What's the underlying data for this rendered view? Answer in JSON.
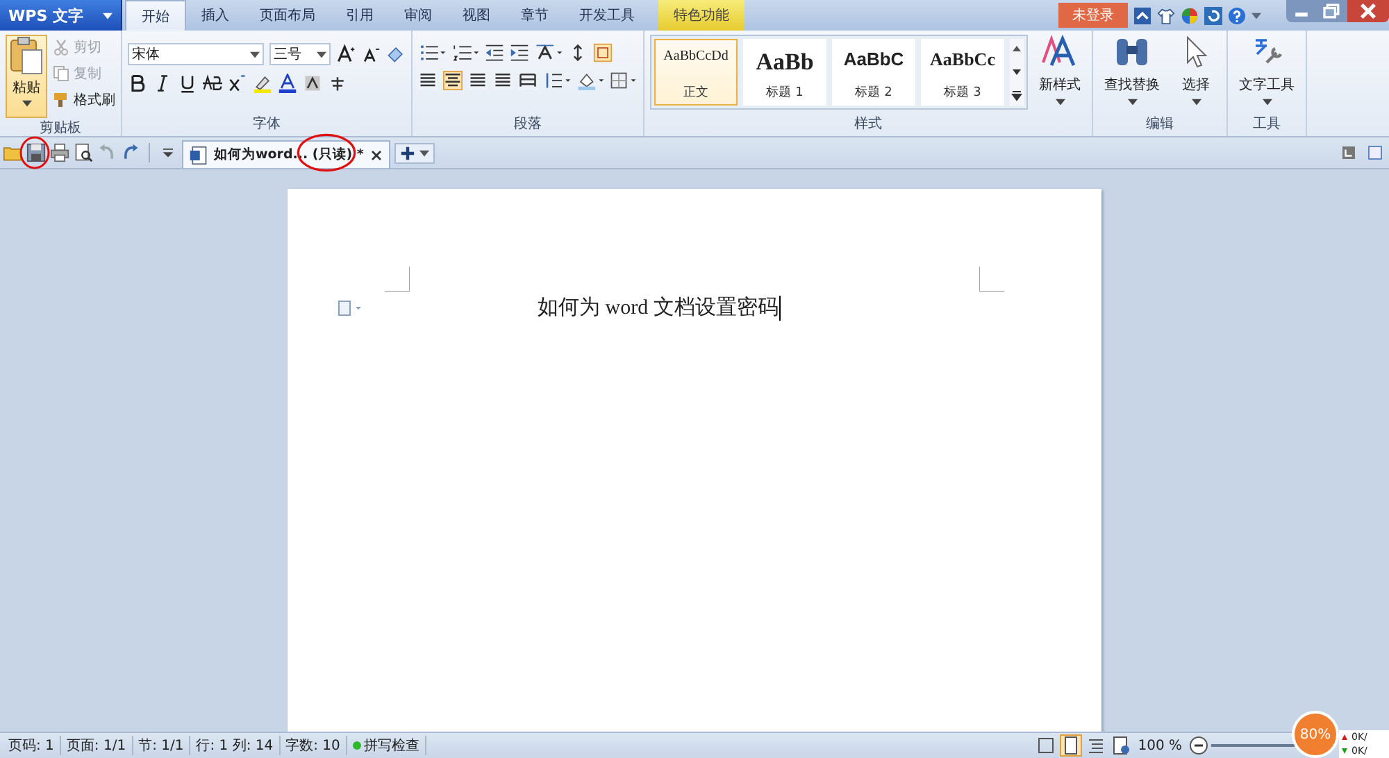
{
  "app_menu": {
    "label": "WPS 文字"
  },
  "tabs": [
    {
      "label": "开始",
      "selected": true,
      "kind": "normal"
    },
    {
      "label": "插入",
      "selected": false,
      "kind": "normal"
    },
    {
      "label": "页面布局",
      "selected": false,
      "kind": "normal"
    },
    {
      "label": "引用",
      "selected": false,
      "kind": "normal"
    },
    {
      "label": "审阅",
      "selected": false,
      "kind": "normal"
    },
    {
      "label": "视图",
      "selected": false,
      "kind": "normal"
    },
    {
      "label": "章节",
      "selected": false,
      "kind": "normal"
    },
    {
      "label": "开发工具",
      "selected": false,
      "kind": "normal"
    },
    {
      "label": "特色功能",
      "selected": false,
      "kind": "feature"
    }
  ],
  "account": {
    "label": "未登录"
  },
  "clipboard": {
    "paste": "粘贴",
    "items": [
      {
        "label": "剪切",
        "disabled": true
      },
      {
        "label": "复制",
        "disabled": true
      },
      {
        "label": "格式刷",
        "disabled": false
      }
    ],
    "label": "剪贴板"
  },
  "font": {
    "name": "宋体",
    "size": "三号",
    "label": "字体"
  },
  "paragraph": {
    "label": "段落",
    "alignments": [
      {
        "selected": false
      },
      {
        "selected": true
      },
      {
        "selected": false
      },
      {
        "selected": false
      },
      {
        "selected": false
      }
    ]
  },
  "styles": {
    "items": [
      {
        "preview": "AaBbCcDd",
        "name": "正文",
        "selected": true,
        "kind": "body"
      },
      {
        "preview": "AaBb",
        "name": "标题 1",
        "selected": false,
        "kind": "h1"
      },
      {
        "preview": "AaBbC",
        "name": "标题 2",
        "selected": false,
        "kind": "h2"
      },
      {
        "preview": "AaBbCc",
        "name": "标题 3",
        "selected": false,
        "kind": "h3"
      }
    ],
    "new_style": "新样式",
    "label": "样式"
  },
  "editing": {
    "find_replace": "查找替换",
    "select": "选择",
    "label": "编辑"
  },
  "tools": {
    "text_tools": "文字工具",
    "label": "工具"
  },
  "document_tab": {
    "title": "如何为word... (只读) *"
  },
  "document": {
    "text": "如何为 word 文档设置密码"
  },
  "status_bar": {
    "items": [
      "页码: 1",
      "页面: 1/1",
      "节: 1/1",
      "行: 1  列: 14",
      "字数: 10"
    ],
    "spell_check": "拼写检查",
    "zoom": "100 %"
  },
  "overlay": {
    "percent": "80%",
    "speeds": [
      "0K/",
      "0K/"
    ]
  }
}
